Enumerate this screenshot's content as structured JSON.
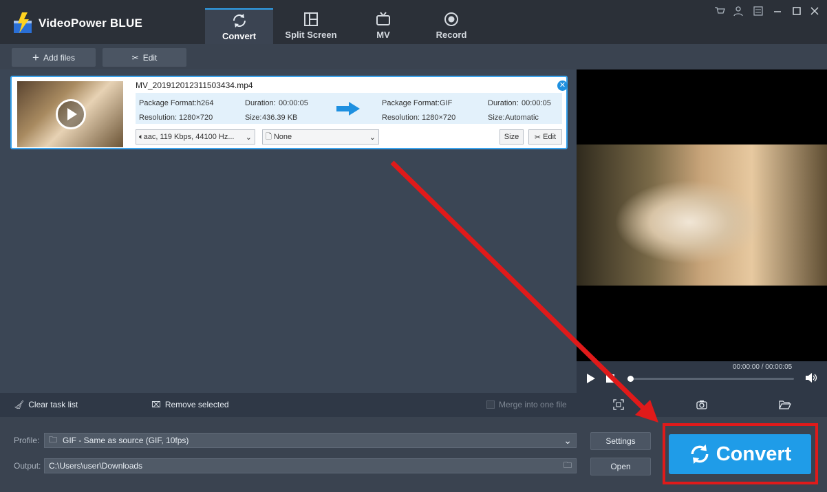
{
  "app": {
    "title": "VideoPower BLUE"
  },
  "tabs": [
    {
      "label": "Convert",
      "icon": "refresh-icon",
      "active": true
    },
    {
      "label": "Split Screen",
      "icon": "split-screen-icon",
      "active": false
    },
    {
      "label": "MV",
      "icon": "tv-icon",
      "active": false
    },
    {
      "label": "Record",
      "icon": "record-icon",
      "active": false
    }
  ],
  "toolbar": {
    "add_files": "Add files",
    "edit": "Edit"
  },
  "task": {
    "filename": "MV_201912012311503434.mp4",
    "source": {
      "format_label": "Package Format:",
      "format": "h264",
      "resolution_label": "Resolution:",
      "resolution": "1280×720",
      "duration_label": "Duration:",
      "duration": "00:00:05",
      "size_label": "Size:",
      "size": "436.39 KB"
    },
    "target": {
      "format_label": "Package Format:",
      "format": "GIF",
      "resolution_label": "Resolution:",
      "resolution": "1280×720",
      "duration_label": "Duration:",
      "duration": "00:00:05",
      "size_label": "Size:",
      "size": "Automatic"
    },
    "audio_track": "aac, 119 Kbps, 44100 Hz...",
    "subtitle": "None",
    "size_button": "Size",
    "edit_button": "Edit"
  },
  "preview": {
    "time": "00:00:00 / 00:00:05",
    "progress": 0.0
  },
  "taskbar": {
    "clear": "Clear task list",
    "remove": "Remove selected",
    "merge": "Merge into one file",
    "merge_checked": false
  },
  "bottom": {
    "profile_label": "Profile:",
    "profile_value": "GIF - Same as source (GIF, 10fps)",
    "output_label": "Output:",
    "output_value": "C:\\Users\\user\\Downloads",
    "settings": "Settings",
    "open": "Open",
    "convert": "Convert"
  },
  "colors": {
    "accent": "#1f9ce8",
    "highlight": "#e01a1a",
    "tab_indicator": "#2fa0ea"
  }
}
